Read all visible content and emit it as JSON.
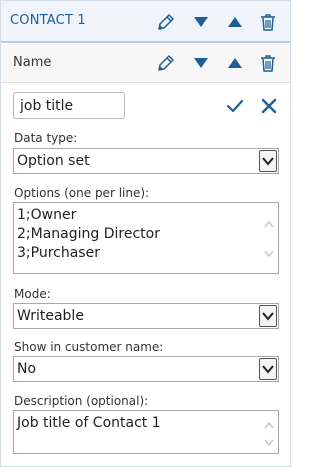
{
  "header": {
    "title": "CONTACT 1"
  },
  "subheader": {
    "title": "Name"
  },
  "editor": {
    "field_value": "job title",
    "data_type_label": "Data type:",
    "data_type_value": "Option set",
    "options_label": "Options (one per line):",
    "options_lines": [
      "1;Owner",
      "2;Managing Director",
      "3;Purchaser"
    ],
    "mode_label": "Mode:",
    "mode_value": "Writeable",
    "show_name_label": "Show in customer name:",
    "show_name_value": "No",
    "description_label": "Description (optional):",
    "description_value": "Job title of Contact 1"
  },
  "colors": {
    "accent": "#1e5f95",
    "header_bg": "#eef4fa",
    "subhead_bg": "#f7f7f7"
  }
}
